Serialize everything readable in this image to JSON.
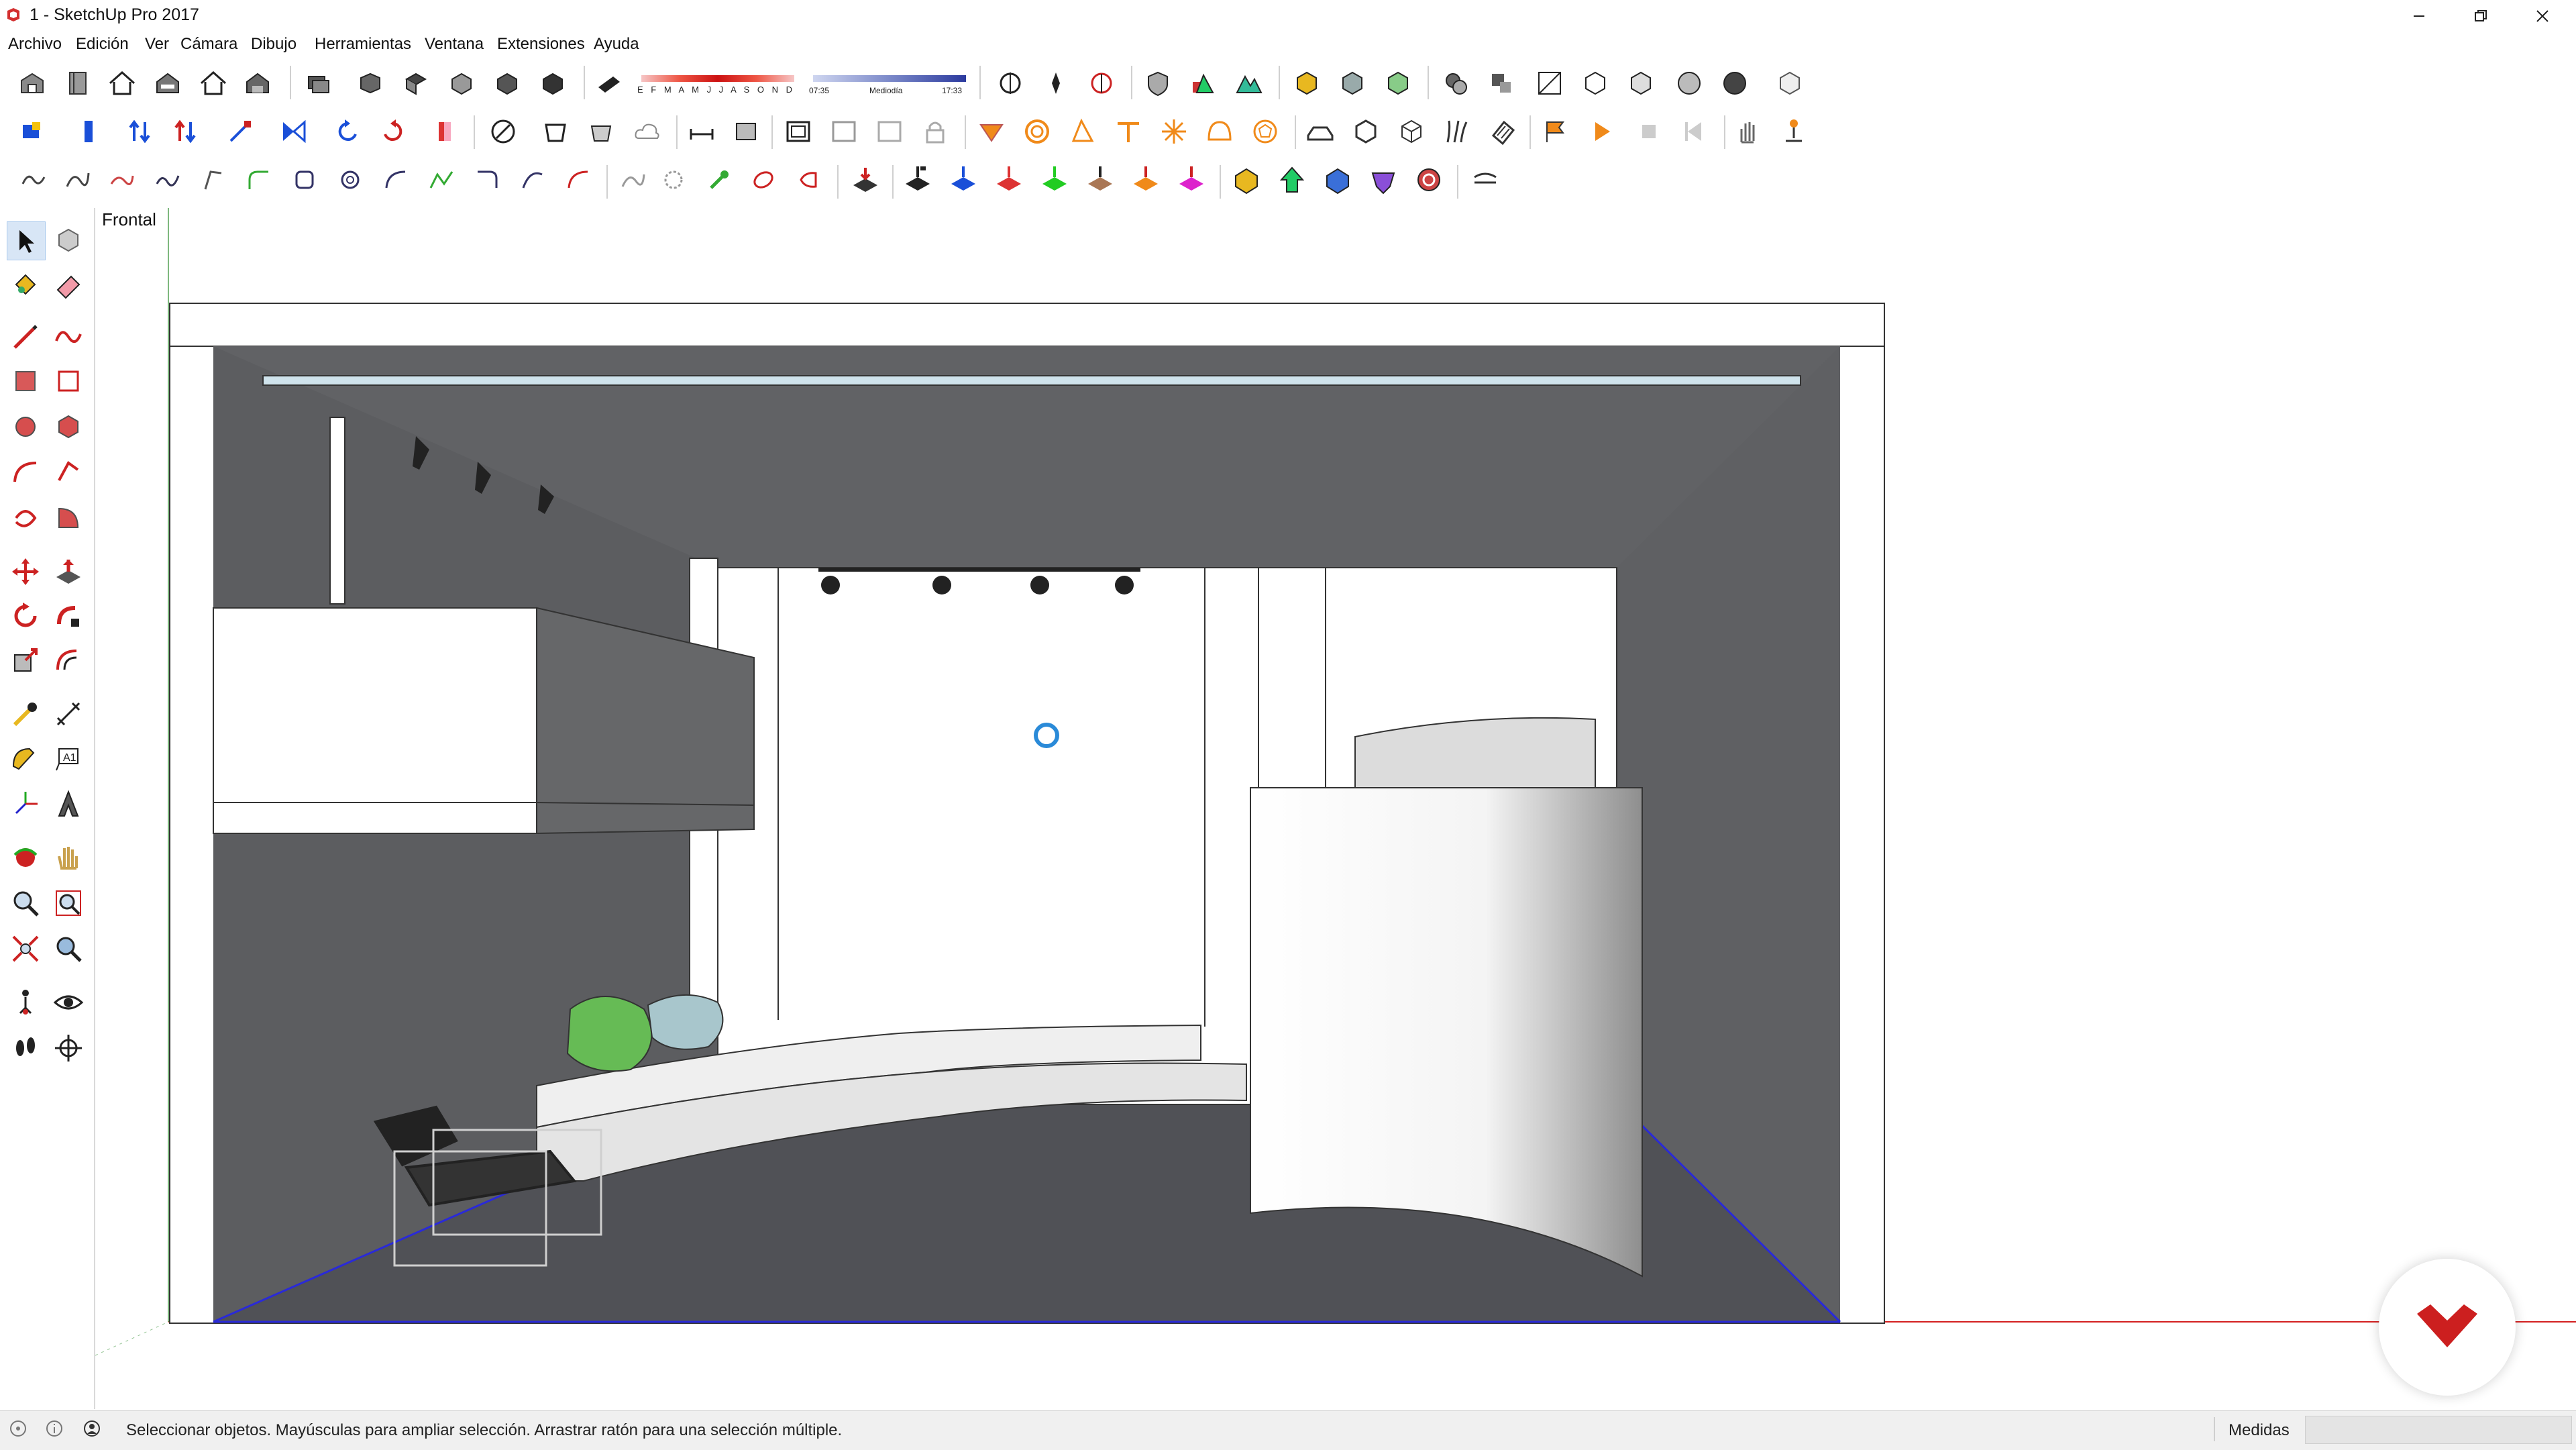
{
  "window": {
    "title": "1 - SketchUp Pro 2017",
    "minimize_icon": "minimize-icon",
    "restore_icon": "restore-icon",
    "close_icon": "close-icon"
  },
  "menu": {
    "items": [
      "Archivo",
      "Edición",
      "Ver",
      "Cámara",
      "Dibujo",
      "Herramientas",
      "Ventana",
      "Extensiones",
      "Ayuda"
    ]
  },
  "shadow_toolbar": {
    "months": "E F M A M J J A S O N D",
    "time_start": "07:35",
    "time_mid": "Mediodía",
    "time_end": "17:33"
  },
  "viewport": {
    "scene_tab": "Frontal"
  },
  "status": {
    "hint": "Seleccionar objetos. Mayúsculas para ampliar selección. Arrastrar ratón para una selección múltiple.",
    "measures_label": "Medidas",
    "measures_value": ""
  },
  "colors": {
    "accent_red": "#cc1f1f",
    "axis_blue": "#2a2ad8",
    "axis_red": "#d42020",
    "wall_gray": "#5a5b5e",
    "floor_gray": "#505156",
    "ceiling_gray": "#6b6c6f"
  }
}
